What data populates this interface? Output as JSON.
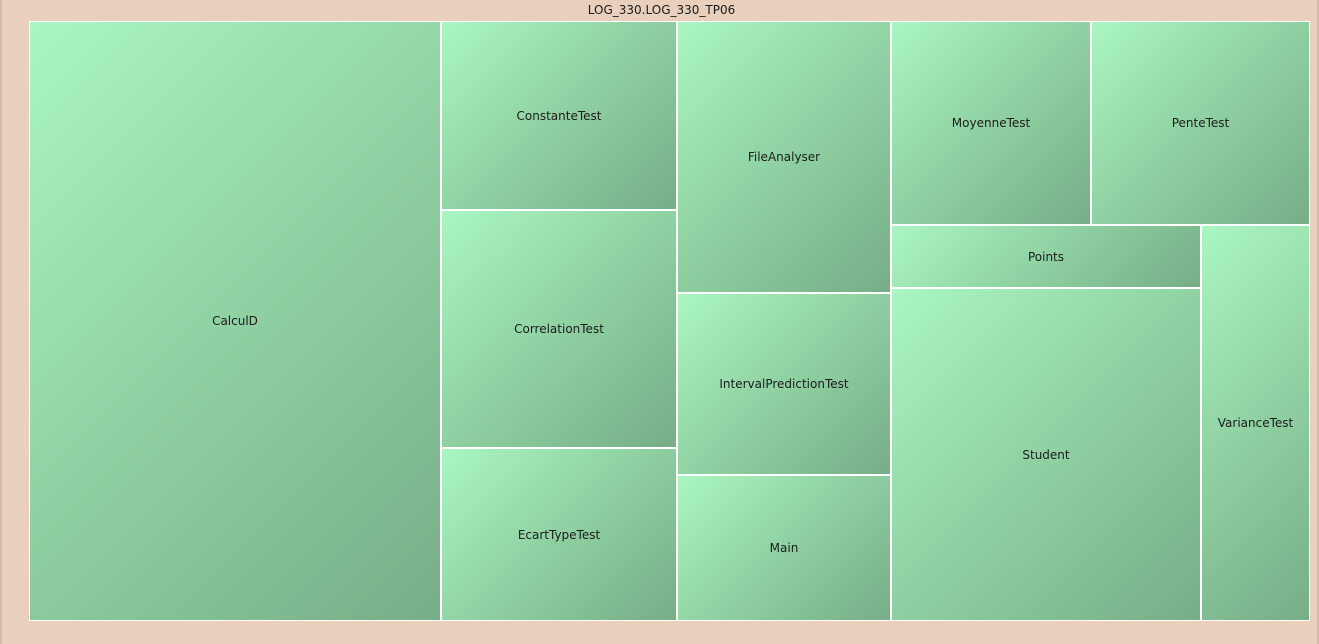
{
  "title": "LOG_330.LOG_330_TP06",
  "cells": [
    {
      "label": "CalculD"
    },
    {
      "label": "ConstanteTest"
    },
    {
      "label": "CorrelationTest"
    },
    {
      "label": "EcartTypeTest"
    },
    {
      "label": "FileAnalyser"
    },
    {
      "label": "IntervalPredictionTest"
    },
    {
      "label": "Main"
    },
    {
      "label": "MoyenneTest"
    },
    {
      "label": "PenteTest"
    },
    {
      "label": "Points"
    },
    {
      "label": "Student"
    },
    {
      "label": "VarianceTest"
    }
  ]
}
